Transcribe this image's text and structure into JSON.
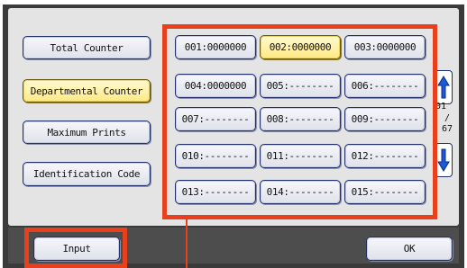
{
  "left_menu": {
    "total_counter": "Total Counter",
    "departmental_counter": "Departmental Counter",
    "maximum_prints": "Maximum Prints",
    "identification_code": "Identification Code"
  },
  "counters": [
    [
      "001:0000000",
      "002:0000000",
      "003:0000000"
    ],
    [
      "004:0000000",
      "005:--------",
      "006:--------"
    ],
    [
      "007:--------",
      "008:--------",
      "009:--------"
    ],
    [
      "010:--------",
      "011:--------",
      "012:--------"
    ],
    [
      "013:--------",
      "014:--------",
      "015:--------"
    ]
  ],
  "selected_counter": "002:0000000",
  "pagination": {
    "current": "01",
    "separator": "/",
    "total": "67"
  },
  "bottom": {
    "input_label": "Input",
    "ok_label": "OK"
  },
  "colors": {
    "highlight": "#e8401c",
    "selected_fill": "#ffe884",
    "arrow_blue": "#1d5bd6"
  }
}
